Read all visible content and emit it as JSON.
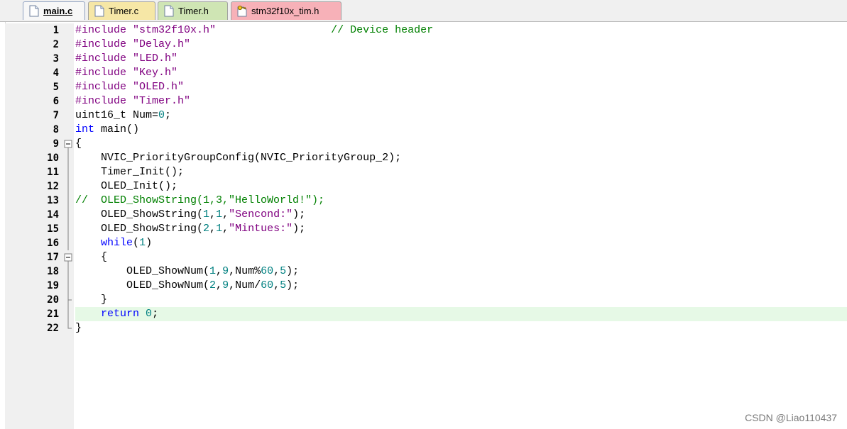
{
  "tabs": [
    {
      "label": "main.c",
      "active": true,
      "icon": "file-icon"
    },
    {
      "label": "Timer.c",
      "active": false,
      "icon": "file-icon"
    },
    {
      "label": "Timer.h",
      "active": false,
      "icon": "file-icon"
    },
    {
      "label": "stm32f10x_tim.h",
      "active": false,
      "icon": "file-key-icon"
    }
  ],
  "editor": {
    "current_line": 21,
    "line_numbers": [
      "1",
      "2",
      "3",
      "4",
      "5",
      "6",
      "7",
      "8",
      "9",
      "10",
      "11",
      "12",
      "13",
      "14",
      "15",
      "16",
      "17",
      "18",
      "19",
      "20",
      "21",
      "22"
    ],
    "code": [
      [
        {
          "t": "#include ",
          "c": "pp"
        },
        {
          "t": "\"stm32f10x.h\"",
          "c": "str"
        },
        {
          "t": "                  ",
          "c": ""
        },
        {
          "t": "// Device header",
          "c": "cmt"
        }
      ],
      [
        {
          "t": "#include ",
          "c": "pp"
        },
        {
          "t": "\"Delay.h\"",
          "c": "str"
        }
      ],
      [
        {
          "t": "#include ",
          "c": "pp"
        },
        {
          "t": "\"LED.h\"",
          "c": "str"
        }
      ],
      [
        {
          "t": "#include ",
          "c": "pp"
        },
        {
          "t": "\"Key.h\"",
          "c": "str"
        }
      ],
      [
        {
          "t": "#include ",
          "c": "pp"
        },
        {
          "t": "\"OLED.h\"",
          "c": "str"
        }
      ],
      [
        {
          "t": "#include ",
          "c": "pp"
        },
        {
          "t": "\"Timer.h\"",
          "c": "str"
        }
      ],
      [
        {
          "t": "uint16_t Num=",
          "c": ""
        },
        {
          "t": "0",
          "c": "num"
        },
        {
          "t": ";",
          "c": ""
        }
      ],
      [
        {
          "t": "int",
          "c": "kw"
        },
        {
          "t": " main()",
          "c": ""
        }
      ],
      [
        {
          "t": "{",
          "c": ""
        }
      ],
      [
        {
          "t": "    NVIC_PriorityGroupConfig(NVIC_PriorityGroup_2);",
          "c": ""
        }
      ],
      [
        {
          "t": "    Timer_Init();",
          "c": ""
        }
      ],
      [
        {
          "t": "    OLED_Init();",
          "c": ""
        }
      ],
      [
        {
          "t": "//  OLED_ShowString(1,3,\"HelloWorld!\");",
          "c": "cmt"
        }
      ],
      [
        {
          "t": "    OLED_ShowString(",
          "c": ""
        },
        {
          "t": "1",
          "c": "num"
        },
        {
          "t": ",",
          "c": ""
        },
        {
          "t": "1",
          "c": "num"
        },
        {
          "t": ",",
          "c": ""
        },
        {
          "t": "\"Sencond:\"",
          "c": "str"
        },
        {
          "t": ");",
          "c": ""
        }
      ],
      [
        {
          "t": "    OLED_ShowString(",
          "c": ""
        },
        {
          "t": "2",
          "c": "num"
        },
        {
          "t": ",",
          "c": ""
        },
        {
          "t": "1",
          "c": "num"
        },
        {
          "t": ",",
          "c": ""
        },
        {
          "t": "\"Mintues:\"",
          "c": "str"
        },
        {
          "t": ");",
          "c": ""
        }
      ],
      [
        {
          "t": "    ",
          "c": ""
        },
        {
          "t": "while",
          "c": "kw"
        },
        {
          "t": "(",
          "c": ""
        },
        {
          "t": "1",
          "c": "num"
        },
        {
          "t": ")",
          "c": ""
        }
      ],
      [
        {
          "t": "    {",
          "c": ""
        }
      ],
      [
        {
          "t": "        OLED_ShowNum(",
          "c": ""
        },
        {
          "t": "1",
          "c": "num"
        },
        {
          "t": ",",
          "c": ""
        },
        {
          "t": "9",
          "c": "num"
        },
        {
          "t": ",Num%",
          "c": ""
        },
        {
          "t": "60",
          "c": "num"
        },
        {
          "t": ",",
          "c": ""
        },
        {
          "t": "5",
          "c": "num"
        },
        {
          "t": ");",
          "c": ""
        }
      ],
      [
        {
          "t": "        OLED_ShowNum(",
          "c": ""
        },
        {
          "t": "2",
          "c": "num"
        },
        {
          "t": ",",
          "c": ""
        },
        {
          "t": "9",
          "c": "num"
        },
        {
          "t": ",Num/",
          "c": ""
        },
        {
          "t": "60",
          "c": "num"
        },
        {
          "t": ",",
          "c": ""
        },
        {
          "t": "5",
          "c": "num"
        },
        {
          "t": ");",
          "c": ""
        }
      ],
      [
        {
          "t": "    }",
          "c": ""
        }
      ],
      [
        {
          "t": "    ",
          "c": ""
        },
        {
          "t": "return",
          "c": "kw"
        },
        {
          "t": " ",
          "c": ""
        },
        {
          "t": "0",
          "c": "num"
        },
        {
          "t": ";",
          "c": ""
        }
      ],
      [
        {
          "t": "}",
          "c": ""
        }
      ]
    ],
    "fold_markers": {
      "9": "open",
      "17": "open",
      "20": "end-inner",
      "22": "end"
    }
  },
  "watermark": "CSDN @Liao110437"
}
